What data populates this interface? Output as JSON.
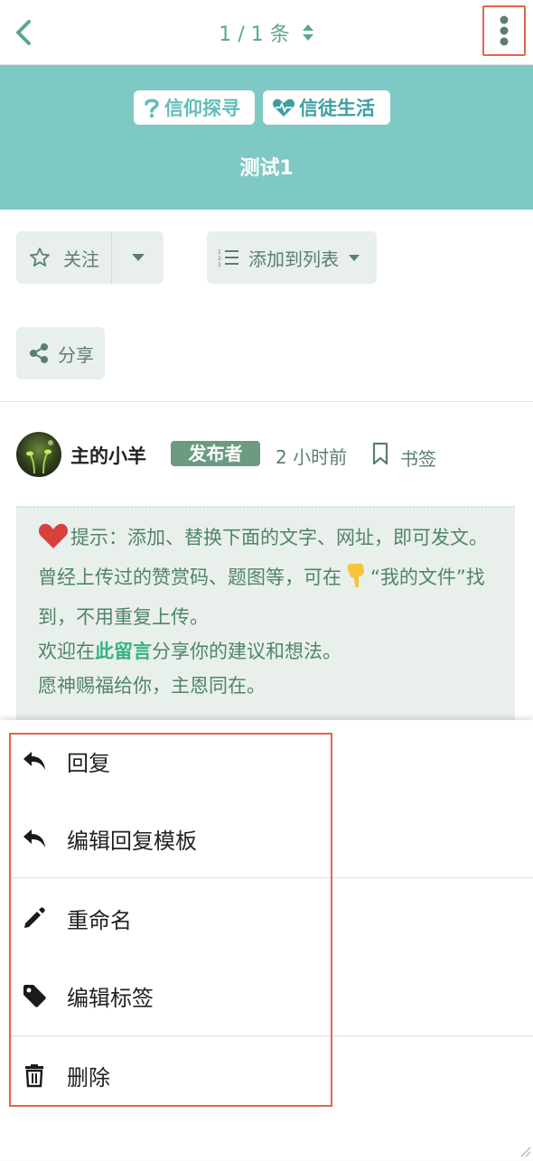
{
  "header": {
    "counter": "1 / 1 条"
  },
  "banner": {
    "tags": [
      "信仰探寻",
      "信徒生活"
    ],
    "title": "测试1"
  },
  "actions": {
    "follow_label": "关注",
    "add_to_list_label": "添加到列表",
    "share_label": "分享"
  },
  "post": {
    "author": "主的小羊",
    "role_badge": "发布者",
    "time": "2 小时前",
    "bookmark_label": "书签",
    "content": {
      "line1": "提示：添加、替换下面的文字、网址，即可发文。",
      "line2a": "曾经上传过的赞赏码、题图等，可在",
      "line2b": "“我的文件”找到，不用重复上传。",
      "line3a": "欢迎在",
      "line3_link": "此留言",
      "line3b": "分享你的建议和想法。",
      "line4": "愿神赐福给你，主恩同在。"
    }
  },
  "menu": {
    "items": [
      {
        "label": "回复",
        "icon": "reply-icon"
      },
      {
        "label": "编辑回复模板",
        "icon": "reply-icon"
      },
      {
        "label": "重命名",
        "icon": "pencil-icon"
      },
      {
        "label": "编辑标签",
        "icon": "tag-icon"
      },
      {
        "label": "删除",
        "icon": "trash-icon"
      }
    ]
  },
  "colors": {
    "accent": "#5aa889",
    "banner": "#7ec9c4",
    "highlight_outline": "#e2664a"
  }
}
